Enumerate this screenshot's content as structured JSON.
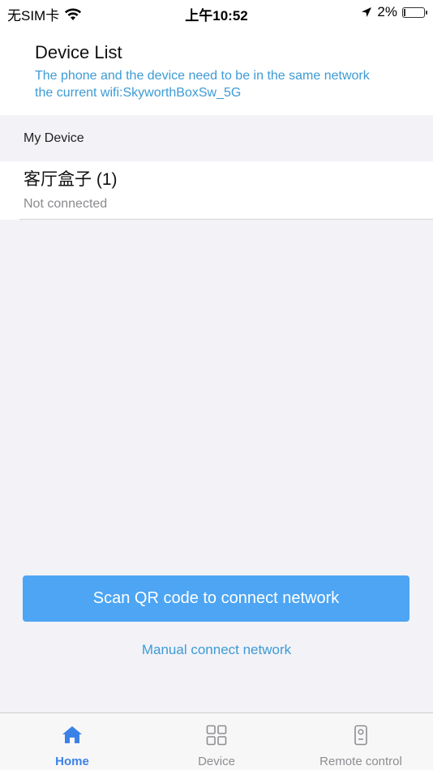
{
  "status_bar": {
    "carrier": "无SIM卡",
    "time": "上午10:52",
    "battery_percent": "2%",
    "battery_level": 0.02
  },
  "header": {
    "title": "Device List",
    "hint_line1": "The phone and the device need to be in the same network",
    "hint_line2": "the current wifi:SkyworthBoxSw_5G"
  },
  "my_device": {
    "section_label": "My Device",
    "items": [
      {
        "name": "客厅盒子 (1)",
        "status": "Not connected"
      }
    ]
  },
  "actions": {
    "scan_button": "Scan QR code to connect network",
    "manual_link": "Manual connect network"
  },
  "tabs": [
    {
      "label": "Home",
      "icon": "home-icon",
      "active": true
    },
    {
      "label": "Device",
      "icon": "grid-icon",
      "active": false
    },
    {
      "label": "Remote control",
      "icon": "remote-icon",
      "active": false
    }
  ],
  "colors": {
    "accent": "#4da5f3",
    "link": "#3d9bd5",
    "tab_active": "#3b82e8"
  }
}
